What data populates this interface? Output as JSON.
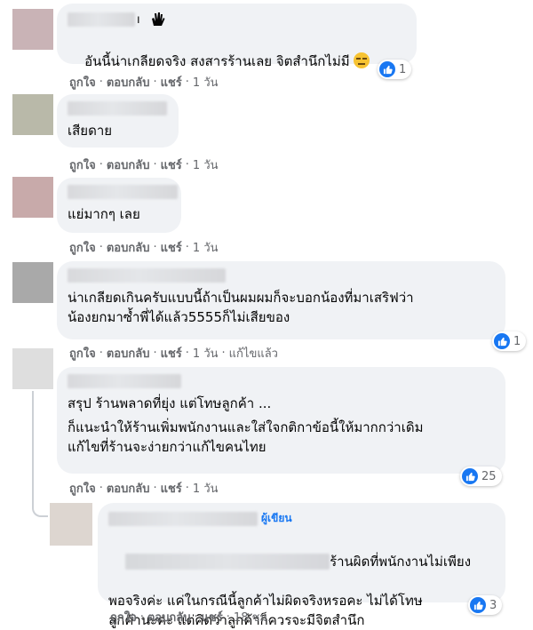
{
  "actions": {
    "like": "ถูกใจ",
    "reply": "ตอบกลับ",
    "share": "แชร์",
    "edited": "แก้ไขแล้ว"
  },
  "colors": {
    "accent": "#1877f2",
    "bubble": "#f0f2f5",
    "meta": "#65676b"
  },
  "comments": [
    {
      "text": "อันนี้น่าเกลียดจริง สงสารร้านเลย จิตสำนึกไม่มี",
      "time": "1 วัน",
      "reaction_count": "1",
      "icon": "raised-hand-icon",
      "emoji": "expressionless-face-icon"
    },
    {
      "text": "เสียดาย",
      "time": "1 วัน"
    },
    {
      "text": "แย่มากๆ เลย",
      "time": "1 วัน"
    },
    {
      "text": "น่าเกลียดเกินครับแบบนี้ถ้าเป็นผมผมก็จะบอกน้องที่มาเสริฟว่า\nน้องยกมาซ้ำพี่ได้แล้ว5555ก็ไม่เสียของ",
      "time": "1 วัน",
      "reaction_count": "1"
    },
    {
      "text_1": "สรุป ร้านพลาดที่ยุ่ง แต่โทษลูกค้า ...",
      "text_2": "ก็แนะนำให้ร้านเพิ่มพนักงานและใส่ใจกติกาข้อนี้ให้มากกว่าเดิม\nแก้ไขที่ร้านจะง่ายกว่าแก้ไขคนไทย",
      "time": "1 วัน",
      "reaction_count": "25"
    }
  ],
  "reply": {
    "badge": "ผู้เขียน",
    "text_line1": "ร้านผิดที่พนักงานไม่เพียง",
    "text_rest": "พอจริงค่ะ แค่ในกรณีนี้ลูกค้าไม่ผิดจริงหรอคะ ไม่ได้โทษ\nลูกค้านะคะ แต่คิดว่าลูกค้าก็ควรจะมีจิตสำนึก",
    "time": "18 ชม.",
    "reaction_count": "3"
  }
}
